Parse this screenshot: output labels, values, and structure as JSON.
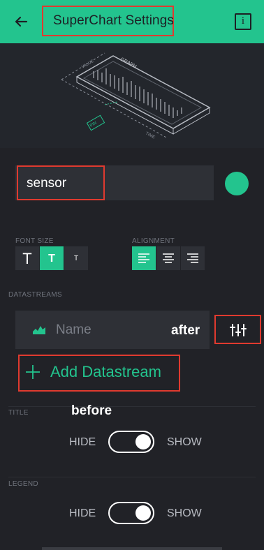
{
  "header": {
    "title": "SuperChart Settings",
    "back_icon": "arrow-left-icon",
    "info_icon": "info-icon",
    "info_glyph": "i"
  },
  "illustration": {
    "graph_label": "GRAPH",
    "value_label": "VALUE",
    "time_label": "TIME",
    "pin_label": "PIN"
  },
  "name_field": {
    "value": "sensor"
  },
  "colors": {
    "accent": "#23c48e",
    "background": "#212227",
    "annotation": "#e03a2f"
  },
  "font_size": {
    "label": "FONT SIZE",
    "options": [
      "T",
      "T",
      "T"
    ],
    "selected_index": 1
  },
  "alignment": {
    "label": "ALIGNMENT",
    "options": [
      "align-left-icon",
      "align-center-icon",
      "align-right-icon"
    ],
    "selected_index": 0
  },
  "datastreams": {
    "label": "DATASTREAMS",
    "item_placeholder": "Name",
    "add_label": "Add Datastream"
  },
  "annotations": {
    "after": "after",
    "before": "before"
  },
  "title_section": {
    "label": "TITLE",
    "hide": "HIDE",
    "show": "SHOW",
    "state": "show"
  },
  "legend_section": {
    "label": "LEGEND",
    "hide": "HIDE",
    "show": "SHOW",
    "state": "show"
  }
}
